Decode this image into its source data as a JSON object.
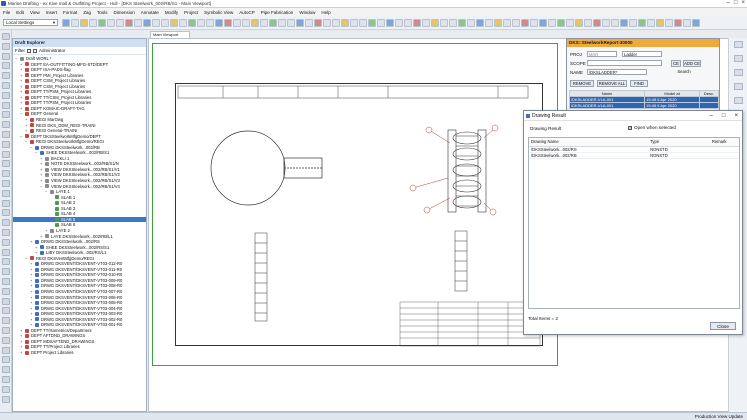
{
  "window": {
    "title": "Marine Drafting - ex Kive mall & Outfitting Project - Hull - [DKS Steelwork_002/RB/S1 - Main Viewport]"
  },
  "menubar": {
    "items": [
      "File",
      "Edit",
      "View",
      "Insert",
      "Format",
      "Zag",
      "Tools",
      "Dimension",
      "Annotate",
      "Modify",
      "Project",
      "Symbolic View",
      "AutoCP",
      "Pipe Fabrication",
      "Window",
      "Help"
    ]
  },
  "toolbar": {
    "settings_combo": "Local Settings"
  },
  "explorer": {
    "title": "Draft Explorer",
    "filter_label": "Filter",
    "administrator_label": "Administrator",
    "tree": [
      {
        "label": "Draft WORL *",
        "depth": 0,
        "icon": "gray",
        "exp": "−"
      },
      {
        "label": "DEPT EA-OUTFITTING-MFG-STD/DEPT",
        "depth": 1,
        "icon": "red",
        "exp": "+"
      },
      {
        "label": "DEPT ISA-PADS-flag",
        "depth": 1,
        "icon": "red",
        "exp": "+"
      },
      {
        "label": "DEPT PMI_Project Libraries",
        "depth": 1,
        "icon": "red",
        "exp": "+"
      },
      {
        "label": "DEPT CSM_Project Libraries",
        "depth": 1,
        "icon": "red",
        "exp": "+"
      },
      {
        "label": "DEPT CSM_Project Libraries",
        "depth": 1,
        "icon": "red",
        "exp": "+"
      },
      {
        "label": "DEPT TT/PSM_Project Libraries",
        "depth": 1,
        "icon": "red",
        "exp": "+"
      },
      {
        "label": "DEPT TT/CSM_Project Libraries",
        "depth": 1,
        "icon": "red",
        "exp": "+"
      },
      {
        "label": "DEPT TT/PSM_Project Libraries",
        "depth": 1,
        "icon": "red",
        "exp": "+"
      },
      {
        "label": "DEPT KOMAIC-DRAFT-TAG",
        "depth": 1,
        "icon": "red",
        "exp": "+"
      },
      {
        "label": "DEPT General",
        "depth": 1,
        "icon": "red",
        "exp": "−"
      },
      {
        "label": "REGI MarOwg",
        "depth": 2,
        "icon": "red",
        "exp": "+"
      },
      {
        "label": "REGI DKS_DDM_REGI-TRAINI",
        "depth": 2,
        "icon": "red",
        "exp": "+"
      },
      {
        "label": "REGI General-TRAINI",
        "depth": 2,
        "icon": "red",
        "exp": "+"
      },
      {
        "label": "DEPT DKSSteelworkMfgDemo/DEPT",
        "depth": 1,
        "icon": "red",
        "exp": "−"
      },
      {
        "label": "REGI DKSSteelworkMfgDemo/REGI",
        "depth": 2,
        "icon": "red",
        "exp": "−"
      },
      {
        "label": "DRWG DKSSteelwork...002/RB",
        "depth": 3,
        "icon": "blue",
        "exp": "−"
      },
      {
        "label": "SHEE DKSSteelwork...002/RB/S1",
        "depth": 4,
        "icon": "blue",
        "exp": "−"
      },
      {
        "label": "BACKLI 1",
        "depth": 5,
        "icon": "gray",
        "exp": "+"
      },
      {
        "label": "NOTE DKSSteelwork...002/RB/S1/N",
        "depth": 5,
        "icon": "gray",
        "exp": "+"
      },
      {
        "label": "VIEW DKSSteelwork...002/RB/S1/V1",
        "depth": 5,
        "icon": "gray",
        "exp": "+"
      },
      {
        "label": "VIEW DKSSteelwork...002/RB/S1/V2",
        "depth": 5,
        "icon": "gray",
        "exp": "+"
      },
      {
        "label": "VIEW DKSSteelwork...002/RB/S1/V3",
        "depth": 5,
        "icon": "gray",
        "exp": "+"
      },
      {
        "label": "VIEW DKSSteelwork...002/RB/S1/V4",
        "depth": 5,
        "icon": "gray",
        "exp": "−"
      },
      {
        "label": "LAYE 1",
        "depth": 6,
        "icon": "gray",
        "exp": "−"
      },
      {
        "label": "SLAB 1",
        "depth": 7,
        "icon": "green",
        "exp": ""
      },
      {
        "label": "SLAB 2",
        "depth": 7,
        "icon": "green",
        "exp": ""
      },
      {
        "label": "SLAB 3",
        "depth": 7,
        "icon": "green",
        "exp": ""
      },
      {
        "label": "SLAB 4",
        "depth": 7,
        "icon": "green",
        "exp": ""
      },
      {
        "label": "SLAB 5",
        "depth": 7,
        "icon": "green",
        "exp": "",
        "selected": true
      },
      {
        "label": "SLAB 6",
        "depth": 7,
        "icon": "green",
        "exp": ""
      },
      {
        "label": "LAYE 2",
        "depth": 6,
        "icon": "gray",
        "exp": "+"
      },
      {
        "label": "LAYE DKSSteelwork...002/RB/L1",
        "depth": 5,
        "icon": "gray",
        "exp": "+"
      },
      {
        "label": "DRWG DKSSteelwork...002/RS",
        "depth": 3,
        "icon": "blue",
        "exp": "+"
      },
      {
        "label": "SHEE DKSSteelwork...002/RS/S1",
        "depth": 4,
        "icon": "blue",
        "exp": "+"
      },
      {
        "label": "LIBY DKSSteelwork...002/RS/L1",
        "depth": 4,
        "icon": "blue",
        "exp": "+"
      },
      {
        "label": "REGI DKSVentMfgDemo/REGI",
        "depth": 2,
        "icon": "red",
        "exp": "−"
      },
      {
        "label": "DRWG DKSVENT/DKSVENT-VT03-012-R0",
        "depth": 3,
        "icon": "blue",
        "exp": "+"
      },
      {
        "label": "DRWG DKSVENT/DKSVENT-VT03-011-R0",
        "depth": 3,
        "icon": "blue",
        "exp": "+"
      },
      {
        "label": "DRWG DKSVENT/DKSVENT-VT03-010-R0",
        "depth": 3,
        "icon": "blue",
        "exp": "+"
      },
      {
        "label": "DRWG DKSVENT/DKSVENT-VT03-009-R0",
        "depth": 3,
        "icon": "blue",
        "exp": "+"
      },
      {
        "label": "DRWG DKSVENT/DKSVENT-VT03-008-R0",
        "depth": 3,
        "icon": "blue",
        "exp": "+"
      },
      {
        "label": "DRWG DKSVENT/DKSVENT-VT03-007-R0",
        "depth": 3,
        "icon": "blue",
        "exp": "+"
      },
      {
        "label": "DRWG DKSVENT/DKSVENT-VT03-006-R0",
        "depth": 3,
        "icon": "blue",
        "exp": "+"
      },
      {
        "label": "DRWG DKSVENT/DKSVENT-VT03-005-R0",
        "depth": 3,
        "icon": "blue",
        "exp": "+"
      },
      {
        "label": "DRWG DKSVENT/DKSVENT-VT03-004-R0",
        "depth": 3,
        "icon": "blue",
        "exp": "+"
      },
      {
        "label": "DRWG DKSVENT/DKSVENT-VT03-003-R0",
        "depth": 3,
        "icon": "blue",
        "exp": "+"
      },
      {
        "label": "DRWG DKSVENT/DKSVENT-VT03-002-R0",
        "depth": 3,
        "icon": "blue",
        "exp": "+"
      },
      {
        "label": "DRWG DKSVENT/DKSVENT-VT03-001-R0",
        "depth": 3,
        "icon": "blue",
        "exp": "+"
      },
      {
        "label": "DEPT TT/Isometrics/Department",
        "depth": 1,
        "icon": "red",
        "exp": "+"
      },
      {
        "label": "DEPT AFTDND_DRAWINGS",
        "depth": 1,
        "icon": "red",
        "exp": "+"
      },
      {
        "label": "DEPT MDSAFTEND_DRAWINGS",
        "depth": 1,
        "icon": "red",
        "exp": "+"
      },
      {
        "label": "DEPT TT/Project Libraries",
        "depth": 1,
        "icon": "red",
        "exp": "+"
      },
      {
        "label": "DEPT Project Libraries",
        "depth": 1,
        "icon": "red",
        "exp": "+"
      }
    ]
  },
  "canvas": {
    "sheet_tab": "Main Viewport"
  },
  "dks_panel": {
    "title": "DKS::SteelworkReport-30000",
    "proj_label": "PROJ",
    "proj_value": "MAR",
    "type_value": "Ladder",
    "scope_label": "SCOPE",
    "ce_label": "CE",
    "add_ce_label": "ADD CE",
    "name_label": "NAME",
    "name_value": "/DKSLADDER*",
    "search_label": "Search",
    "remove_label": "REMOVE",
    "remove_all_label": "REMOVE ALL",
    "find_label": "FIND",
    "columns": [
      "Name",
      "Model at",
      "Desc."
    ],
    "rows": [
      [
        "/DKSLADDER-VLA-001",
        "15:45 5 Apr 2020",
        ""
      ],
      [
        "/DKSLADDER-VLA-001",
        "15:45 5 Apr 2020",
        ""
      ]
    ]
  },
  "drawing_result": {
    "title": "Drawing Result",
    "heading": "Drawing Result",
    "open_when_selected": "Open when selected",
    "columns": [
      "Drawing Name",
      "Type",
      "Remark"
    ],
    "rows": [
      [
        "/DKSSteelwork...002/RS",
        "NONSTD",
        ""
      ],
      [
        "/DKSSteelwork...002/RB",
        "NONSTD",
        ""
      ]
    ],
    "total_items": "Total Items = 2",
    "close_label": "Close"
  },
  "status": {
    "text": "Production View  Update"
  },
  "colors": {
    "dks_header": "#f0a93a",
    "selection": "#3a78c9",
    "frame_green": "#3aa33a",
    "balloon_red": "#c0392b"
  }
}
